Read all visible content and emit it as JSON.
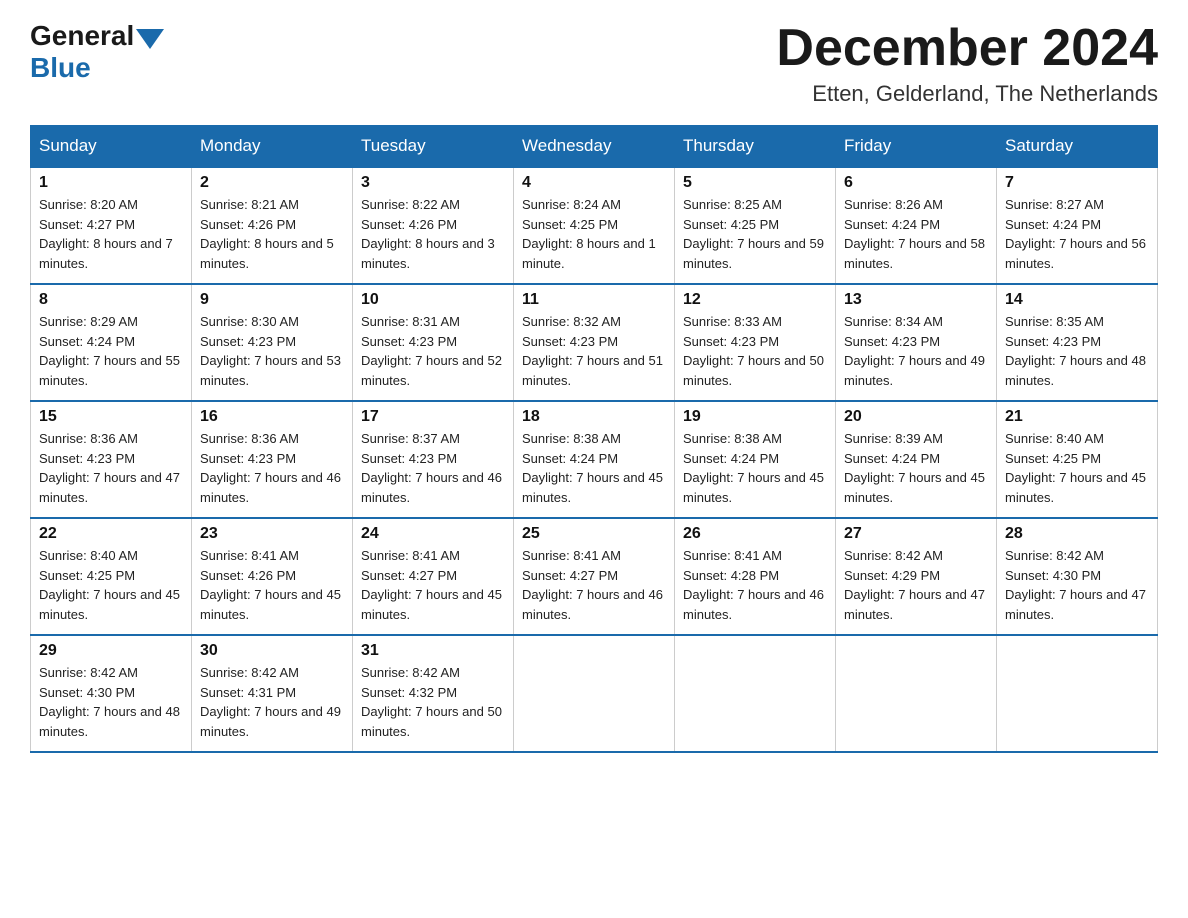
{
  "header": {
    "logo_general": "General",
    "logo_blue": "Blue",
    "main_title": "December 2024",
    "subtitle": "Etten, Gelderland, The Netherlands"
  },
  "days_of_week": [
    "Sunday",
    "Monday",
    "Tuesday",
    "Wednesday",
    "Thursday",
    "Friday",
    "Saturday"
  ],
  "weeks": [
    [
      {
        "day": "1",
        "sunrise": "8:20 AM",
        "sunset": "4:27 PM",
        "daylight": "8 hours and 7 minutes."
      },
      {
        "day": "2",
        "sunrise": "8:21 AM",
        "sunset": "4:26 PM",
        "daylight": "8 hours and 5 minutes."
      },
      {
        "day": "3",
        "sunrise": "8:22 AM",
        "sunset": "4:26 PM",
        "daylight": "8 hours and 3 minutes."
      },
      {
        "day": "4",
        "sunrise": "8:24 AM",
        "sunset": "4:25 PM",
        "daylight": "8 hours and 1 minute."
      },
      {
        "day": "5",
        "sunrise": "8:25 AM",
        "sunset": "4:25 PM",
        "daylight": "7 hours and 59 minutes."
      },
      {
        "day": "6",
        "sunrise": "8:26 AM",
        "sunset": "4:24 PM",
        "daylight": "7 hours and 58 minutes."
      },
      {
        "day": "7",
        "sunrise": "8:27 AM",
        "sunset": "4:24 PM",
        "daylight": "7 hours and 56 minutes."
      }
    ],
    [
      {
        "day": "8",
        "sunrise": "8:29 AM",
        "sunset": "4:24 PM",
        "daylight": "7 hours and 55 minutes."
      },
      {
        "day": "9",
        "sunrise": "8:30 AM",
        "sunset": "4:23 PM",
        "daylight": "7 hours and 53 minutes."
      },
      {
        "day": "10",
        "sunrise": "8:31 AM",
        "sunset": "4:23 PM",
        "daylight": "7 hours and 52 minutes."
      },
      {
        "day": "11",
        "sunrise": "8:32 AM",
        "sunset": "4:23 PM",
        "daylight": "7 hours and 51 minutes."
      },
      {
        "day": "12",
        "sunrise": "8:33 AM",
        "sunset": "4:23 PM",
        "daylight": "7 hours and 50 minutes."
      },
      {
        "day": "13",
        "sunrise": "8:34 AM",
        "sunset": "4:23 PM",
        "daylight": "7 hours and 49 minutes."
      },
      {
        "day": "14",
        "sunrise": "8:35 AM",
        "sunset": "4:23 PM",
        "daylight": "7 hours and 48 minutes."
      }
    ],
    [
      {
        "day": "15",
        "sunrise": "8:36 AM",
        "sunset": "4:23 PM",
        "daylight": "7 hours and 47 minutes."
      },
      {
        "day": "16",
        "sunrise": "8:36 AM",
        "sunset": "4:23 PM",
        "daylight": "7 hours and 46 minutes."
      },
      {
        "day": "17",
        "sunrise": "8:37 AM",
        "sunset": "4:23 PM",
        "daylight": "7 hours and 46 minutes."
      },
      {
        "day": "18",
        "sunrise": "8:38 AM",
        "sunset": "4:24 PM",
        "daylight": "7 hours and 45 minutes."
      },
      {
        "day": "19",
        "sunrise": "8:38 AM",
        "sunset": "4:24 PM",
        "daylight": "7 hours and 45 minutes."
      },
      {
        "day": "20",
        "sunrise": "8:39 AM",
        "sunset": "4:24 PM",
        "daylight": "7 hours and 45 minutes."
      },
      {
        "day": "21",
        "sunrise": "8:40 AM",
        "sunset": "4:25 PM",
        "daylight": "7 hours and 45 minutes."
      }
    ],
    [
      {
        "day": "22",
        "sunrise": "8:40 AM",
        "sunset": "4:25 PM",
        "daylight": "7 hours and 45 minutes."
      },
      {
        "day": "23",
        "sunrise": "8:41 AM",
        "sunset": "4:26 PM",
        "daylight": "7 hours and 45 minutes."
      },
      {
        "day": "24",
        "sunrise": "8:41 AM",
        "sunset": "4:27 PM",
        "daylight": "7 hours and 45 minutes."
      },
      {
        "day": "25",
        "sunrise": "8:41 AM",
        "sunset": "4:27 PM",
        "daylight": "7 hours and 46 minutes."
      },
      {
        "day": "26",
        "sunrise": "8:41 AM",
        "sunset": "4:28 PM",
        "daylight": "7 hours and 46 minutes."
      },
      {
        "day": "27",
        "sunrise": "8:42 AM",
        "sunset": "4:29 PM",
        "daylight": "7 hours and 47 minutes."
      },
      {
        "day": "28",
        "sunrise": "8:42 AM",
        "sunset": "4:30 PM",
        "daylight": "7 hours and 47 minutes."
      }
    ],
    [
      {
        "day": "29",
        "sunrise": "8:42 AM",
        "sunset": "4:30 PM",
        "daylight": "7 hours and 48 minutes."
      },
      {
        "day": "30",
        "sunrise": "8:42 AM",
        "sunset": "4:31 PM",
        "daylight": "7 hours and 49 minutes."
      },
      {
        "day": "31",
        "sunrise": "8:42 AM",
        "sunset": "4:32 PM",
        "daylight": "7 hours and 50 minutes."
      },
      null,
      null,
      null,
      null
    ]
  ],
  "sunrise_label": "Sunrise:",
  "sunset_label": "Sunset:",
  "daylight_label": "Daylight:"
}
